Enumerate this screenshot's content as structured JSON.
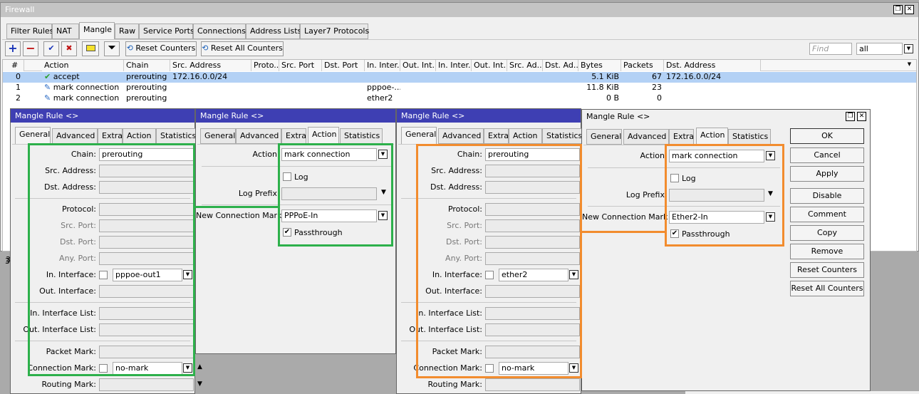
{
  "firewall": {
    "title": "Firewall",
    "tabs": [
      "Filter Rules",
      "NAT",
      "Mangle",
      "Raw",
      "Service Ports",
      "Connections",
      "Address Lists",
      "Layer7 Protocols"
    ],
    "toolbar": {
      "reset_counters": "Reset Counters",
      "reset_all_counters": "Reset All Counters",
      "find_placeholder": "Find",
      "filter_value": "all"
    },
    "columns": [
      "#",
      "Action",
      "Chain",
      "Src. Address",
      "Proto...",
      "Src. Port",
      "Dst. Port",
      "In. Inter...",
      "Out. Int...",
      "In. Inter...",
      "Out. Int...",
      "Src. Ad...",
      "Dst. Ad...",
      "Bytes",
      "Packets",
      "Dst. Address"
    ],
    "rows": [
      {
        "num": "0",
        "action": "accept",
        "chain": "prerouting",
        "src": "172.16.0.0/24",
        "in_if": "",
        "bytes": "5.1 KiB",
        "packets": "67",
        "dst": "172.16.0.0/24"
      },
      {
        "num": "1",
        "action": "mark connection",
        "chain": "prerouting",
        "src": "",
        "in_if": "pppoe-...",
        "bytes": "11.8 KiB",
        "packets": "23",
        "dst": ""
      },
      {
        "num": "2",
        "action": "mark connection",
        "chain": "prerouting",
        "src": "",
        "in_if": "ether2",
        "bytes": "0 B",
        "packets": "0",
        "dst": ""
      }
    ],
    "status_left": "3"
  },
  "dialog_tabs": [
    "General",
    "Advanced",
    "Extra",
    "Action",
    "Statistics"
  ],
  "dialog_title": "Mangle Rule <>",
  "general_labels": {
    "chain": "Chain:",
    "src_address": "Src. Address:",
    "dst_address": "Dst. Address:",
    "protocol": "Protocol:",
    "src_port": "Src. Port:",
    "dst_port": "Dst. Port:",
    "any_port": "Any. Port:",
    "in_interface": "In. Interface:",
    "out_interface": "Out. Interface:",
    "in_interface_list": "In. Interface List:",
    "out_interface_list": "Out. Interface List:",
    "packet_mark": "Packet Mark:",
    "connection_mark": "Connection Mark:",
    "routing_mark": "Routing Mark:"
  },
  "action_labels": {
    "action": "Action",
    "log": "Log",
    "log_prefix": "Log Prefix",
    "new_connection_mark": "New Connection Mark",
    "passthrough": "Passthrough"
  },
  "rule1": {
    "chain": "prerouting",
    "in_interface": "pppoe-out1",
    "connection_mark": "no-mark",
    "action": "mark connection",
    "new_connection_mark": "PPPoE-In"
  },
  "rule2": {
    "chain": "prerouting",
    "in_interface": "ether2",
    "connection_mark": "no-mark",
    "action": "mark connection",
    "new_connection_mark": "Ether2-In"
  },
  "buttons": [
    "OK",
    "Cancel",
    "Apply",
    "Disable",
    "Comment",
    "Copy",
    "Remove",
    "Reset Counters",
    "Reset All Counters"
  ],
  "colors": {
    "title_inactive": "#c4c4c4",
    "title_active": "#3e3fb3",
    "selection": "#b3d1f5",
    "green_highlight": "#2db04b",
    "orange_highlight": "#f28c2e"
  }
}
